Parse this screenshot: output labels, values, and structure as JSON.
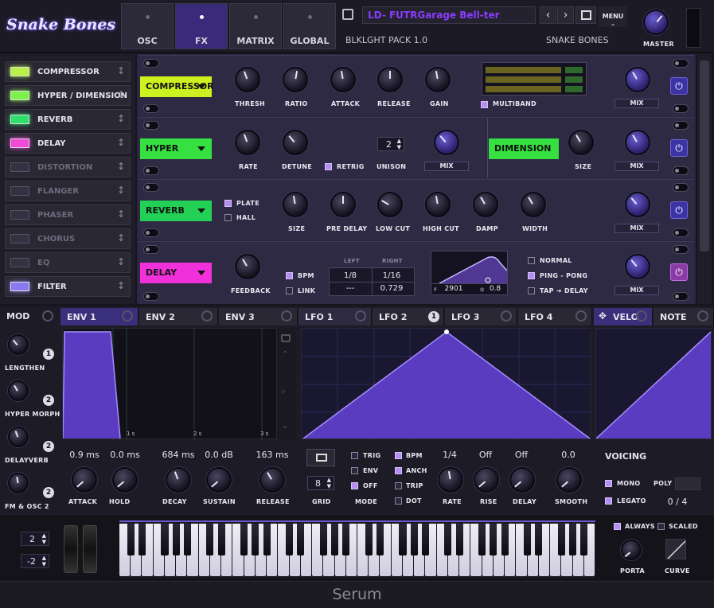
{
  "header": {
    "logo": "Snake Bones",
    "tabs": [
      "OSC",
      "FX",
      "MATRIX",
      "GLOBAL"
    ],
    "active_tab": "FX",
    "preset_name": "LD- FUTRGarage Bell-ter",
    "pack": "BLKLGHT PACK 1.0",
    "author": "SNAKE BONES",
    "menu": "MENU",
    "master": "MASTER"
  },
  "fx_list": [
    {
      "label": "COMPRESSOR",
      "on": true,
      "color": "#b9f04a"
    },
    {
      "label": "HYPER / DIMENSION",
      "on": true,
      "color": "#7ef04a"
    },
    {
      "label": "REVERB",
      "on": true,
      "color": "#2fe06a"
    },
    {
      "label": "DELAY",
      "on": true,
      "color": "#f04ad8"
    },
    {
      "label": "DISTORTION",
      "on": false
    },
    {
      "label": "FLANGER",
      "on": false
    },
    {
      "label": "PHASER",
      "on": false
    },
    {
      "label": "CHORUS",
      "on": false
    },
    {
      "label": "EQ",
      "on": false
    },
    {
      "label": "FILTER",
      "on": true,
      "color": "#8a7af0"
    }
  ],
  "compressor": {
    "name": "COMPRESSOR",
    "knobs": [
      "THRESH",
      "RATIO",
      "ATTACK",
      "RELEASE",
      "GAIN"
    ],
    "multiband": "MULTIBAND",
    "mix": "MIX"
  },
  "hyper": {
    "name": "HYPER",
    "knobs": [
      "RATE",
      "DETUNE"
    ],
    "retrig": "RETRIG",
    "unison_value": "2",
    "unison": "UNISON",
    "mix": "MIX",
    "dimension": "DIMENSION",
    "size": "SIZE",
    "dim_mix": "MIX"
  },
  "reverb": {
    "name": "REVERB",
    "plate": "PLATE",
    "hall": "HALL",
    "knobs": [
      "SIZE",
      "PRE DELAY",
      "LOW CUT",
      "HIGH CUT",
      "DAMP",
      "WIDTH"
    ],
    "mix": "MIX"
  },
  "delay": {
    "name": "DELAY",
    "feedback": "FEEDBACK",
    "bpm": "BPM",
    "link": "LINK",
    "left": "LEFT",
    "right": "RIGHT",
    "left_val1": "1/8",
    "right_val1": "1/16",
    "left_val2": "---",
    "right_val2": "0.729",
    "freq": "2901",
    "q": "0.8",
    "f_label": "F",
    "q_label": "Q",
    "normal": "NORMAL",
    "pingpong": "PING - PONG",
    "tap": "TAP ➔ DELAY",
    "mix": "MIX"
  },
  "mod": {
    "title": "MOD",
    "macros": [
      {
        "label": "LENGTHEN",
        "badge": "1"
      },
      {
        "label": "HYPER MORPH",
        "badge": "2"
      },
      {
        "label": "DELAYVERB",
        "badge": "2"
      },
      {
        "label": "FM & OSC 2",
        "badge": "2"
      }
    ]
  },
  "env": {
    "tabs": [
      "ENV 1",
      "ENV 2",
      "ENV 3"
    ],
    "time_marks": [
      "1 s",
      "2 s",
      "3 s"
    ],
    "values": [
      "0.9 ms",
      "0.0 ms",
      "684 ms",
      "0.0 dB",
      "163 ms"
    ],
    "labels": [
      "ATTACK",
      "HOLD",
      "DECAY",
      "SUSTAIN",
      "RELEASE"
    ]
  },
  "lfo": {
    "tabs": [
      "LFO 1",
      "LFO 2",
      "LFO 3",
      "LFO 4"
    ],
    "lfo2_badge": "1",
    "grid_value": "8",
    "grid": "GRID",
    "mode": "MODE",
    "trig": "TRIG",
    "env": "ENV",
    "off": "OFF",
    "bpm": "BPM",
    "anch": "ANCH",
    "trip": "TRIP",
    "dot": "DOT",
    "rate_val": "1/4",
    "rise_val": "Off",
    "delay_val": "Off",
    "smooth_val": "0.0",
    "knobs": [
      "RATE",
      "RISE",
      "DELAY",
      "SMOOTH"
    ]
  },
  "velo": {
    "tabs": [
      "VELO",
      "NOTE"
    ],
    "voicing": "VOICING",
    "mono": "MONO",
    "poly": "POLY",
    "legato": "LEGATO",
    "voices": "0 / 4"
  },
  "keys": {
    "pitch_up": "2",
    "pitch_down": "-2",
    "always": "ALWAYS",
    "scaled": "SCALED",
    "porta": "PORTA",
    "curve": "CURVE"
  },
  "footer": "Serum"
}
